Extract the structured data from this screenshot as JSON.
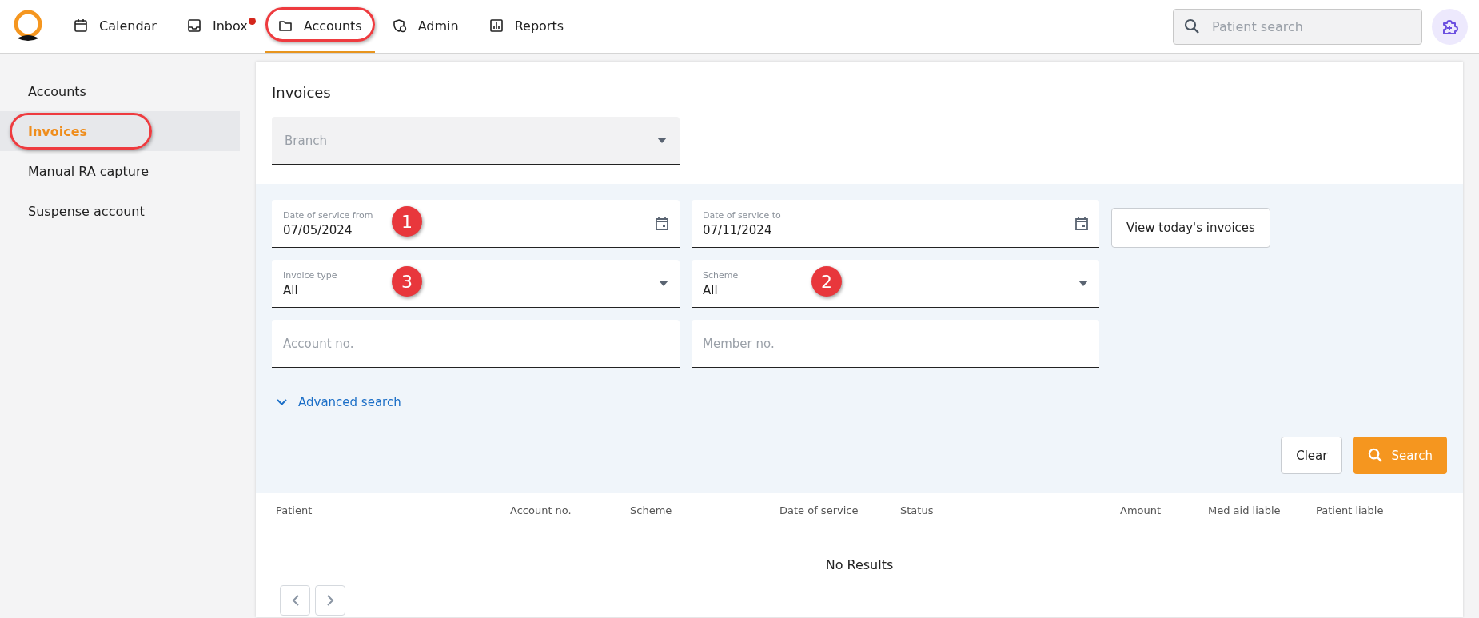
{
  "nav": {
    "items": [
      {
        "label": "Calendar",
        "selected": false,
        "highlighted": false,
        "notification": false
      },
      {
        "label": "Inbox",
        "selected": false,
        "highlighted": false,
        "notification": true
      },
      {
        "label": "Accounts",
        "selected": true,
        "highlighted": true,
        "notification": false
      },
      {
        "label": "Admin",
        "selected": false,
        "highlighted": false,
        "notification": false
      },
      {
        "label": "Reports",
        "selected": false,
        "highlighted": false,
        "notification": false
      }
    ]
  },
  "patient_search": {
    "placeholder": "Patient search"
  },
  "sidebar": {
    "items": [
      {
        "label": "Accounts",
        "selected": false,
        "highlighted": false
      },
      {
        "label": "Invoices",
        "selected": true,
        "highlighted": true
      },
      {
        "label": "Manual RA capture",
        "selected": false,
        "highlighted": false
      },
      {
        "label": "Suspense account",
        "selected": false,
        "highlighted": false
      }
    ]
  },
  "page": {
    "title": "Invoices",
    "branch": {
      "placeholder": "Branch"
    },
    "filters": [
      {
        "kind": "date",
        "label": "Date of service from",
        "value": "07/05/2024",
        "callout": "1"
      },
      {
        "kind": "date",
        "label": "Date of service to",
        "value": "07/11/2024"
      },
      {
        "kind": "select",
        "label": "Invoice type",
        "value": "All",
        "callout": "3"
      },
      {
        "kind": "select",
        "label": "Scheme",
        "value": "All",
        "callout": "2"
      },
      {
        "kind": "text",
        "placeholder": "Account no."
      },
      {
        "kind": "text",
        "placeholder": "Member no."
      }
    ],
    "view_today_button": "View today's invoices",
    "advanced_search": "Advanced search",
    "clear_button": "Clear",
    "search_button": "Search"
  },
  "table": {
    "columns": [
      "Patient",
      "Account no.",
      "Scheme",
      "Date of service",
      "Status",
      "Amount",
      "Med aid liable",
      "Patient liable"
    ],
    "empty_message": "No Results"
  }
}
